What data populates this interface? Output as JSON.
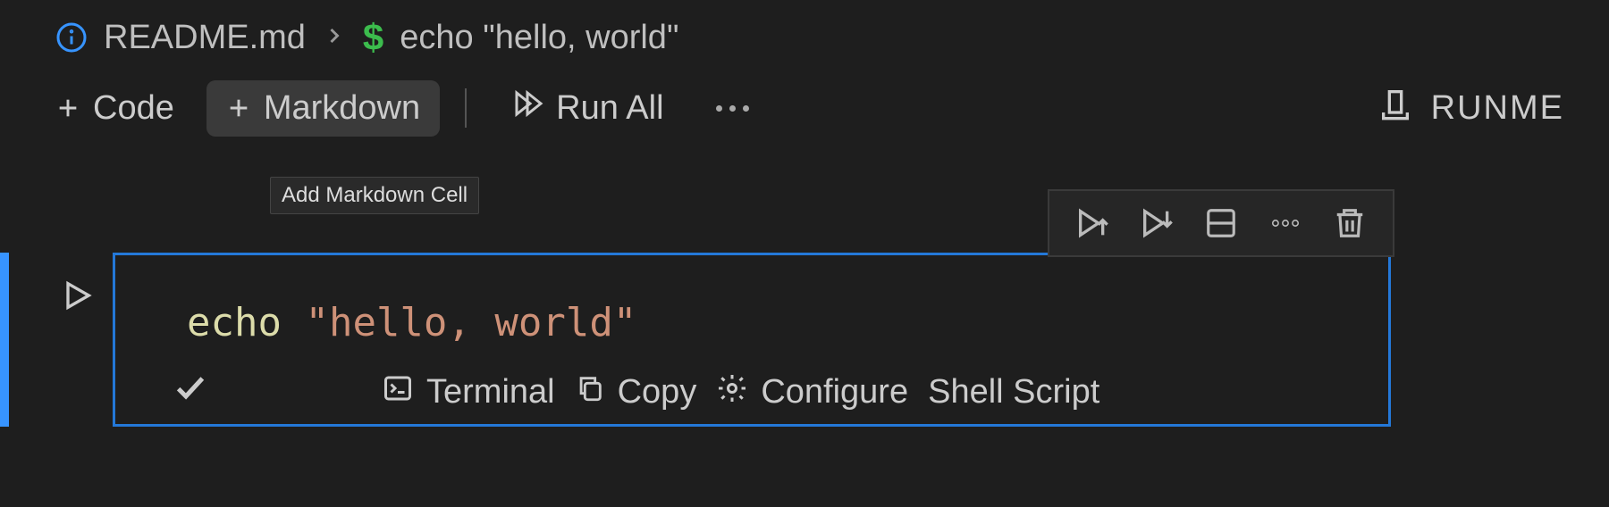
{
  "breadcrumb": {
    "file": "README.md",
    "cell": "echo \"hello, world\""
  },
  "toolbar": {
    "code_label": "Code",
    "markdown_label": "Markdown",
    "runall_label": "Run All",
    "runme_label": "RUNME"
  },
  "tooltip": "Add Markdown Cell",
  "cell": {
    "code": {
      "command": "echo",
      "string": "\"hello, world\""
    },
    "footer": {
      "terminal": "Terminal",
      "copy": "Copy",
      "configure": "Configure",
      "language": "Shell Script"
    }
  }
}
